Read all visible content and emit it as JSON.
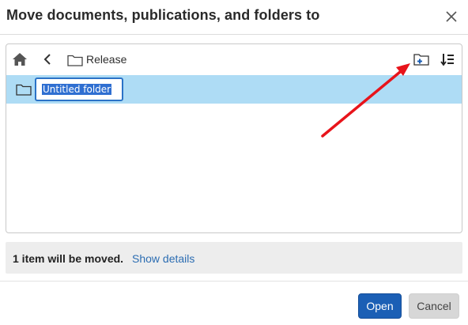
{
  "dialog": {
    "title": "Move documents, publications, and folders to",
    "close_icon": "close-icon"
  },
  "browser": {
    "toolbar": {
      "home_icon": "home-icon",
      "back_icon": "chevron-left-icon",
      "breadcrumb_folder_icon": "folder-icon",
      "breadcrumb_label": "Release",
      "new_folder_icon": "new-folder-icon",
      "sort_icon": "sort-icon"
    },
    "rows": [
      {
        "icon": "folder-icon",
        "name_input_value": "Untitled folder",
        "selected": true,
        "editing": true
      }
    ]
  },
  "info_bar": {
    "count_text": "1 item will be moved.",
    "details_link": "Show details"
  },
  "footer": {
    "open_label": "Open",
    "cancel_label": "Cancel"
  },
  "colors": {
    "selected_row": "#aedcf5",
    "primary_button": "#1b5fb5",
    "link": "#2c6db2",
    "annotation_arrow": "#e8141b"
  }
}
